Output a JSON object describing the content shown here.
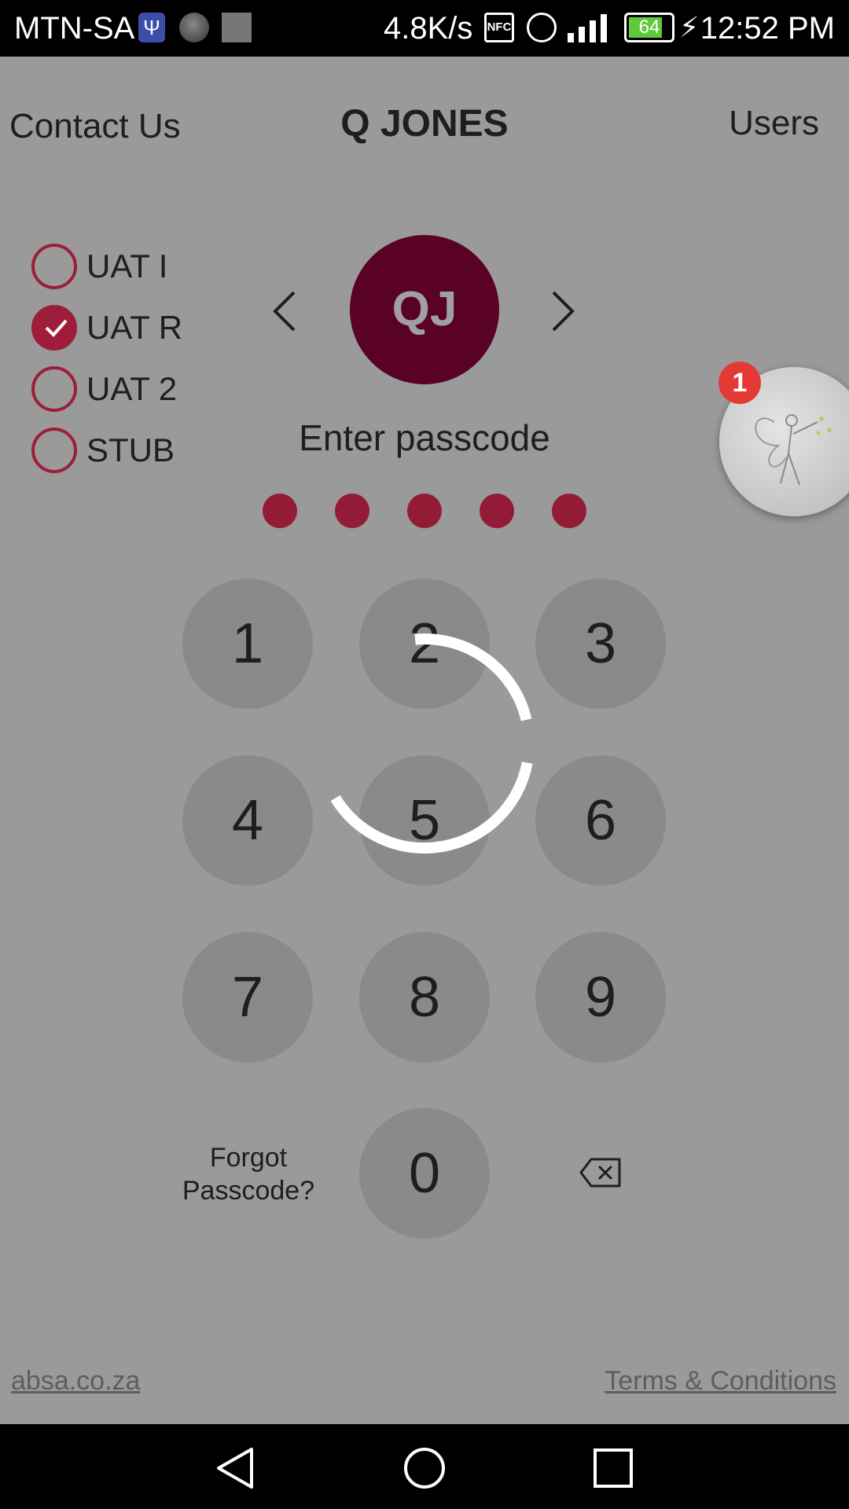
{
  "status_bar": {
    "carrier": "MTN-SA",
    "speed": "4.8K/s",
    "nfc": "NFC",
    "battery_level": "64",
    "time": "12:52 PM",
    "icons": [
      "usb-icon",
      "avatar-thumbnail",
      "image-thumbnail",
      "nfc-icon",
      "alarm-icon",
      "signal-icon",
      "battery-icon",
      "charging-icon"
    ]
  },
  "header": {
    "contact_us": "Contact Us",
    "user_name": "Q JONES",
    "users": "Users"
  },
  "environments": [
    {
      "label": "UAT I",
      "checked": false
    },
    {
      "label": "UAT R",
      "checked": true
    },
    {
      "label": "UAT 2",
      "checked": false
    },
    {
      "label": "STUB",
      "checked": false
    }
  ],
  "user": {
    "initials": "QJ"
  },
  "passcode": {
    "prompt": "Enter passcode",
    "entered_digits": 5
  },
  "notification_badge": "1",
  "keypad": {
    "keys": [
      "1",
      "2",
      "3",
      "4",
      "5",
      "6",
      "7",
      "8",
      "9",
      "0"
    ],
    "forgot_line1": "Forgot",
    "forgot_line2": "Passcode?"
  },
  "footer": {
    "site": "absa.co.za",
    "terms": "Terms & Conditions"
  },
  "colors": {
    "accent": "#9e1d3a",
    "avatar_bg": "#5a0226",
    "overlay": "#9a9a9a"
  }
}
